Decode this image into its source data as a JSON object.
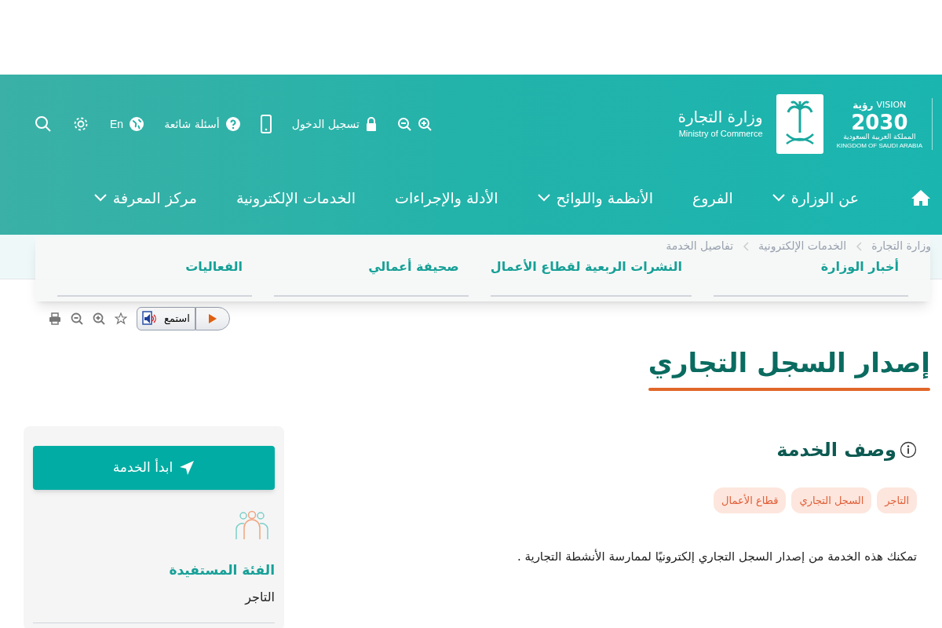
{
  "header": {
    "vision_logo": {
      "word_en": "VISION",
      "word_ar": "رؤية",
      "year": "2030",
      "country_ar": "المملكة العربية السعودية",
      "country_en": "KINGDOM OF SAUDI ARABIA"
    },
    "ministry": {
      "name_ar": "وزارة التجارة",
      "name_en": "Ministry of Commerce"
    },
    "utility": [
      {
        "kind": "zoom"
      },
      {
        "kind": "login",
        "label": "تسجيل الدخول"
      },
      {
        "kind": "mobile"
      },
      {
        "kind": "faq",
        "label": "أسئلة شائعة"
      },
      {
        "kind": "language",
        "label": "En"
      },
      {
        "kind": "settings"
      },
      {
        "kind": "search"
      }
    ]
  },
  "nav": [
    {
      "label": "عن الوزارة",
      "dropdown": true
    },
    {
      "label": "الفروع",
      "dropdown": false
    },
    {
      "label": "الأنظمة واللوائح",
      "dropdown": true
    },
    {
      "label": "الأدلة والإجراءات",
      "dropdown": false
    },
    {
      "label": "الخدمات الإلكترونية",
      "dropdown": false
    },
    {
      "label": "مركز المعرفة",
      "dropdown": true
    }
  ],
  "breadcrumb": [
    "وزارة التجارة",
    "الخدمات الإلكترونية",
    "تفاصيل الخدمة"
  ],
  "dropdown_menu": [
    "أخبار الوزارة",
    "النشرات الربعية لقطاع الأعمال",
    "صحيفة أعمالي",
    "الفعاليات"
  ],
  "listen": {
    "label": "استمع"
  },
  "page_title": "إصدار السجل التجاري",
  "side_card": {
    "start_button": "ابدأ الخدمة",
    "audience_title": "الفئة المستفيدة",
    "audience": "التاجر"
  },
  "description": {
    "title": "وصف الخدمة",
    "tags": [
      "التاجر",
      "السجل التجاري",
      "قطاع الأعمال"
    ],
    "text": "تمكنك هذه الخدمة من إصدار السجل التجاري إلكترونيًا  لممارسة الأنشطة التجارية ."
  }
}
